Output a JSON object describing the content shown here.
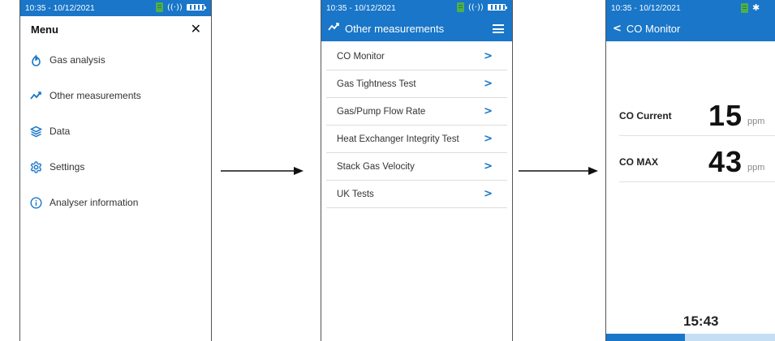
{
  "status": {
    "time": "10:35 - 10/12/2021",
    "radio": "((·))"
  },
  "colors": {
    "accent": "#1976c8",
    "arrow": "#111111",
    "battery_icon": "#4caf50"
  },
  "menu_screen": {
    "title": "Menu",
    "items": [
      {
        "label": "Gas analysis",
        "icon": "flame-icon"
      },
      {
        "label": "Other measurements",
        "icon": "trend-icon"
      },
      {
        "label": "Data",
        "icon": "layers-icon"
      },
      {
        "label": "Settings",
        "icon": "gear-icon"
      },
      {
        "label": "Analyser information",
        "icon": "info-icon"
      }
    ]
  },
  "other_screen": {
    "title": "Other measurements",
    "items": [
      {
        "label": "CO Monitor"
      },
      {
        "label": "Gas Tightness Test"
      },
      {
        "label": "Gas/Pump Flow Rate"
      },
      {
        "label": "Heat Exchanger Integrity Test"
      },
      {
        "label": "Stack Gas Velocity"
      },
      {
        "label": "UK Tests"
      }
    ],
    "chevron": ">"
  },
  "co_screen": {
    "title": "CO Monitor",
    "back": "<",
    "readings": [
      {
        "label": "CO Current",
        "value": "15",
        "unit": "ppm"
      },
      {
        "label": "CO MAX",
        "value": "43",
        "unit": "ppm"
      }
    ],
    "timer": "15:43",
    "progress": 0.44
  }
}
